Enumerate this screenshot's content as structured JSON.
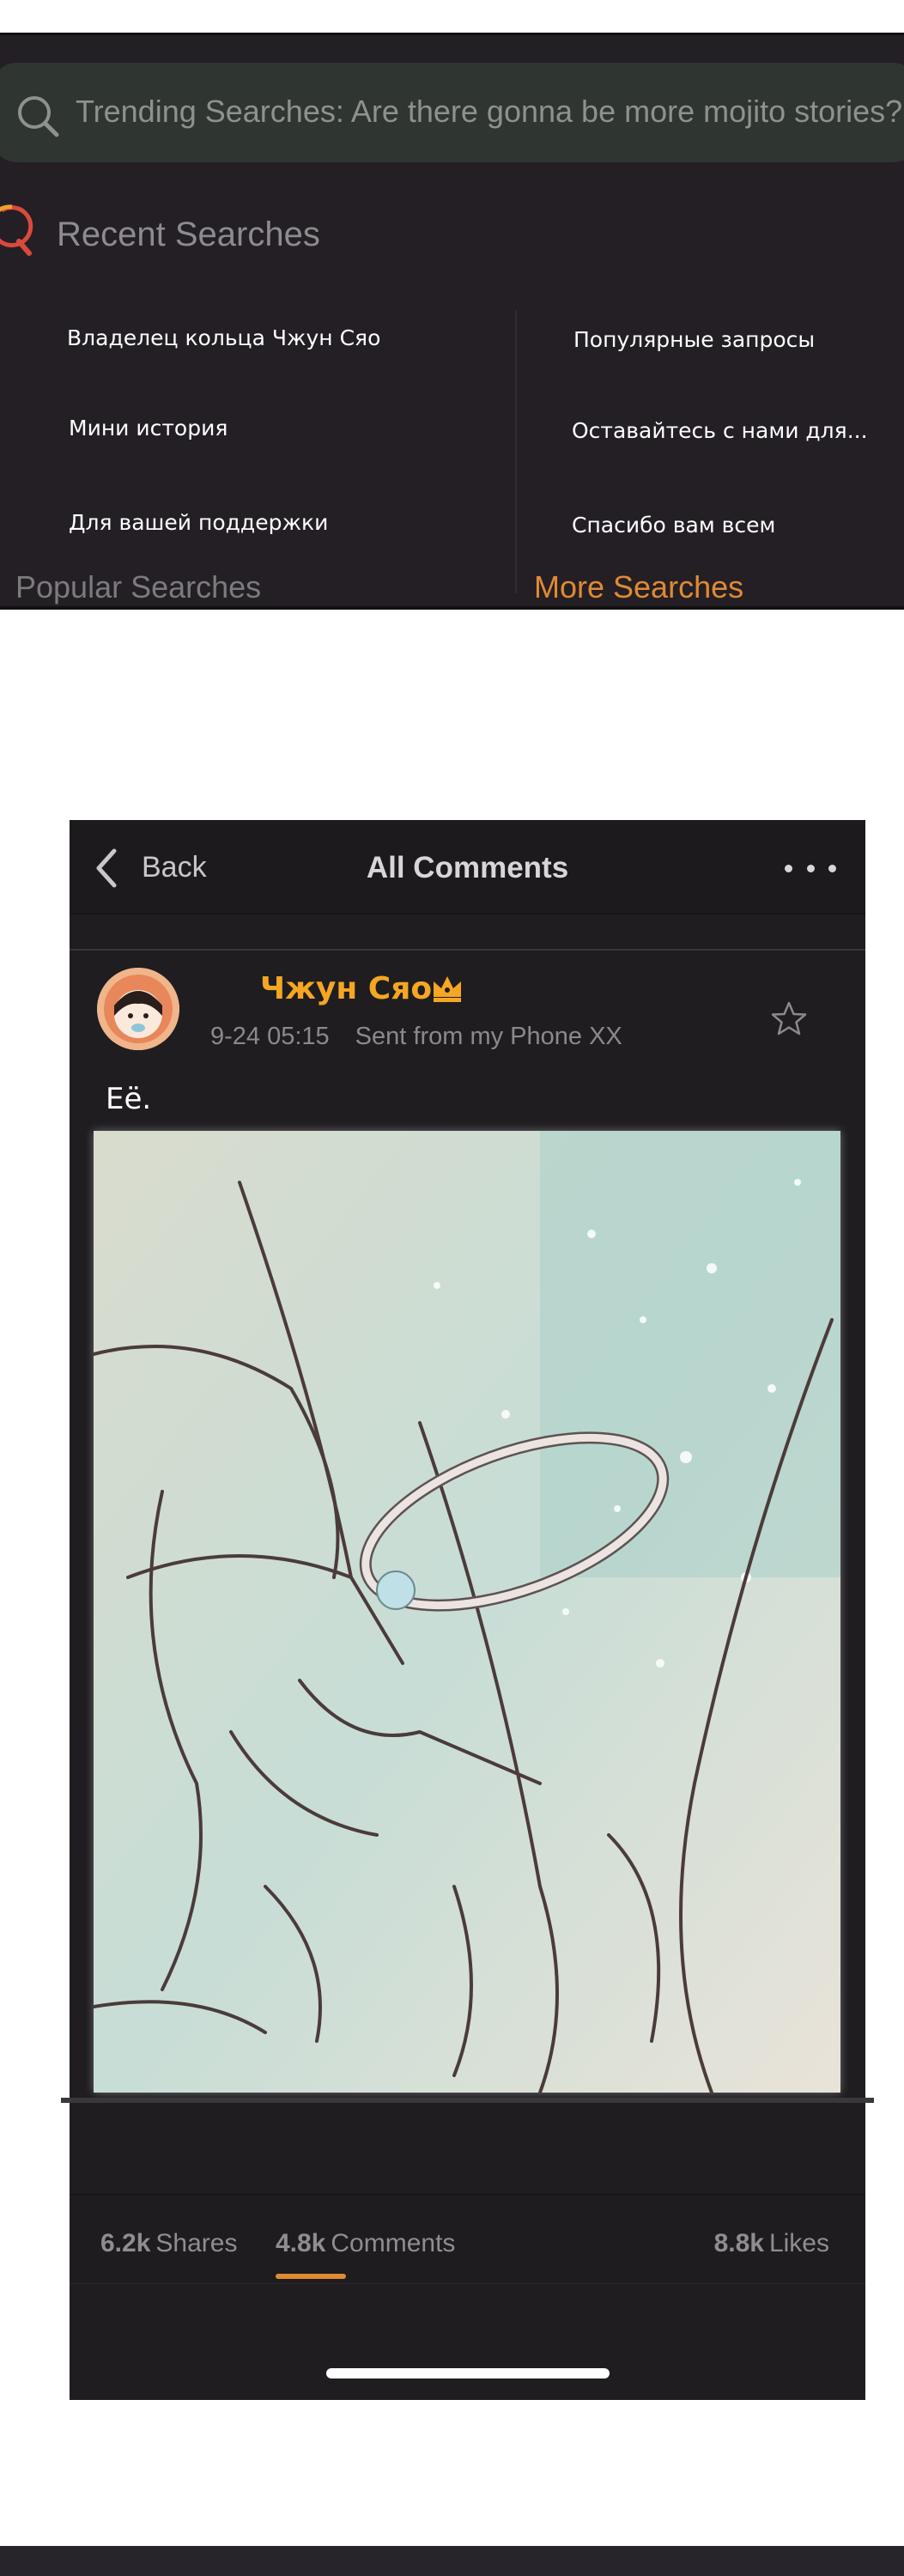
{
  "search": {
    "trending_text": "Trending Searches: Are there gonna be more mojito stories?",
    "recent_title": "Recent Searches",
    "left_items": [
      "Владелец кольца Чжун Сяо",
      "Мини история",
      "Для вашей поддержки"
    ],
    "right_items": [
      "Популярные запросы",
      "Оставайтесь с нами для...",
      "Спасибо вам всем"
    ],
    "popular_label": "Popular Searches",
    "more_label": "More Searches"
  },
  "post": {
    "back_label": "Back",
    "title": "All Comments",
    "author": "Чжун Сяо",
    "date": "9-24 05:15",
    "source": "Sent from my Phone XX",
    "text": "Её."
  },
  "stats": {
    "shares_count": "6.2k",
    "shares_label": "Shares",
    "comments_count": "4.8k",
    "comments_label": "Comments",
    "likes_count": "8.8k",
    "likes_label": "Likes"
  },
  "colors": {
    "accent": "#e08a33",
    "author": "#f5a623",
    "panel_bg": "#231f25",
    "card_bg": "#1f1d20"
  },
  "icons": [
    "search-icon",
    "recent-search-icon",
    "back-chevron-icon",
    "more-dots-icon",
    "crown-icon",
    "star-icon"
  ]
}
